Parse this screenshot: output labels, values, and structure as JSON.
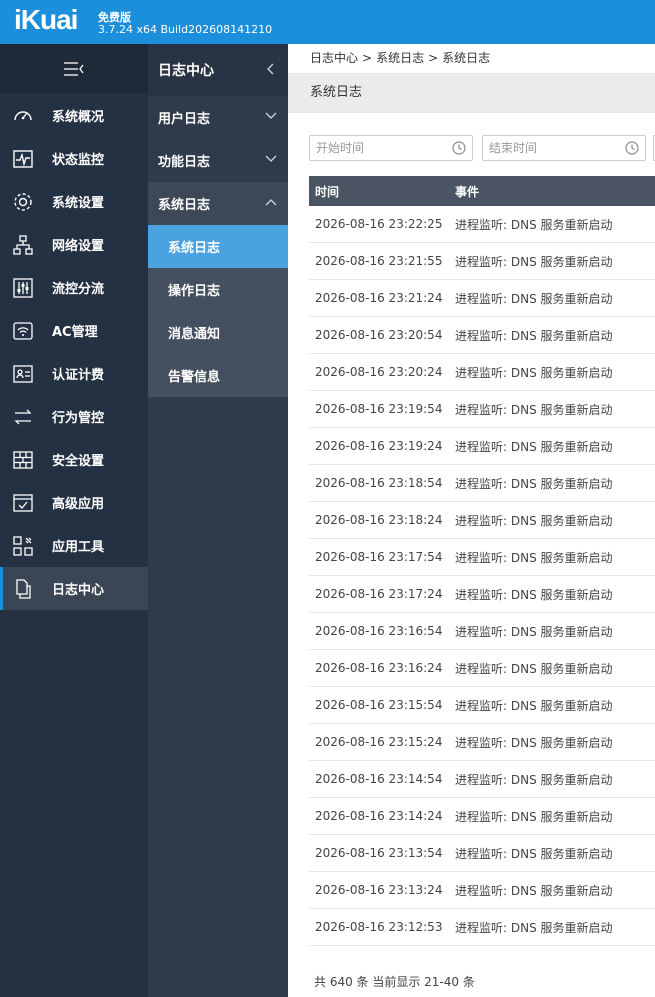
{
  "header": {
    "logo": "iKuai",
    "edition": "免费版",
    "build": "3.7.24 x64 Build202608141210"
  },
  "sidebar": {
    "items": [
      {
        "label": "系统概况",
        "icon": "dashboard-gauge-icon"
      },
      {
        "label": "状态监控",
        "icon": "monitor-pulse-icon"
      },
      {
        "label": "系统设置",
        "icon": "gear-icon"
      },
      {
        "label": "网络设置",
        "icon": "network-tree-icon"
      },
      {
        "label": "流控分流",
        "icon": "sliders-icon"
      },
      {
        "label": "AC管理",
        "icon": "wifi-router-icon"
      },
      {
        "label": "认证计费",
        "icon": "id-card-icon"
      },
      {
        "label": "行为管控",
        "icon": "swap-arrows-icon"
      },
      {
        "label": "安全设置",
        "icon": "firewall-icon"
      },
      {
        "label": "高级应用",
        "icon": "checklist-icon"
      },
      {
        "label": "应用工具",
        "icon": "tools-grid-icon"
      },
      {
        "label": "日志中心",
        "icon": "documents-icon"
      }
    ]
  },
  "submenu": {
    "title": "日志中心",
    "groups": [
      {
        "label": "用户日志"
      },
      {
        "label": "功能日志"
      },
      {
        "label": "系统日志"
      }
    ],
    "children": [
      "系统日志",
      "操作日志",
      "消息通知",
      "告警信息"
    ]
  },
  "breadcrumb": [
    "日志中心",
    "系统日志",
    "系统日志"
  ],
  "breadcrumb_sep": ">",
  "page_title": "系统日志",
  "filters": {
    "start_placeholder": "开始时间",
    "end_placeholder": "结束时间"
  },
  "table": {
    "columns": [
      "时间",
      "事件"
    ],
    "rows": [
      [
        "2026-08-16 23:22:25",
        "进程监听: DNS 服务重新启动"
      ],
      [
        "2026-08-16 23:21:55",
        "进程监听: DNS 服务重新启动"
      ],
      [
        "2026-08-16 23:21:24",
        "进程监听: DNS 服务重新启动"
      ],
      [
        "2026-08-16 23:20:54",
        "进程监听: DNS 服务重新启动"
      ],
      [
        "2026-08-16 23:20:24",
        "进程监听: DNS 服务重新启动"
      ],
      [
        "2026-08-16 23:19:54",
        "进程监听: DNS 服务重新启动"
      ],
      [
        "2026-08-16 23:19:24",
        "进程监听: DNS 服务重新启动"
      ],
      [
        "2026-08-16 23:18:54",
        "进程监听: DNS 服务重新启动"
      ],
      [
        "2026-08-16 23:18:24",
        "进程监听: DNS 服务重新启动"
      ],
      [
        "2026-08-16 23:17:54",
        "进程监听: DNS 服务重新启动"
      ],
      [
        "2026-08-16 23:17:24",
        "进程监听: DNS 服务重新启动"
      ],
      [
        "2026-08-16 23:16:54",
        "进程监听: DNS 服务重新启动"
      ],
      [
        "2026-08-16 23:16:24",
        "进程监听: DNS 服务重新启动"
      ],
      [
        "2026-08-16 23:15:54",
        "进程监听: DNS 服务重新启动"
      ],
      [
        "2026-08-16 23:15:24",
        "进程监听: DNS 服务重新启动"
      ],
      [
        "2026-08-16 23:14:54",
        "进程监听: DNS 服务重新启动"
      ],
      [
        "2026-08-16 23:14:24",
        "进程监听: DNS 服务重新启动"
      ],
      [
        "2026-08-16 23:13:54",
        "进程监听: DNS 服务重新启动"
      ],
      [
        "2026-08-16 23:13:24",
        "进程监听: DNS 服务重新启动"
      ],
      [
        "2026-08-16 23:12:53",
        "进程监听: DNS 服务重新启动"
      ]
    ]
  },
  "footer": {
    "summary": "共 640 条 当前显示 21-40 条"
  },
  "colors": {
    "brand": "#1b8fdc",
    "sidebar_bg": "#233142",
    "submenu_bg": "#2f3b4a",
    "active_child": "#4aa3e0",
    "table_header": "#4b5463"
  }
}
